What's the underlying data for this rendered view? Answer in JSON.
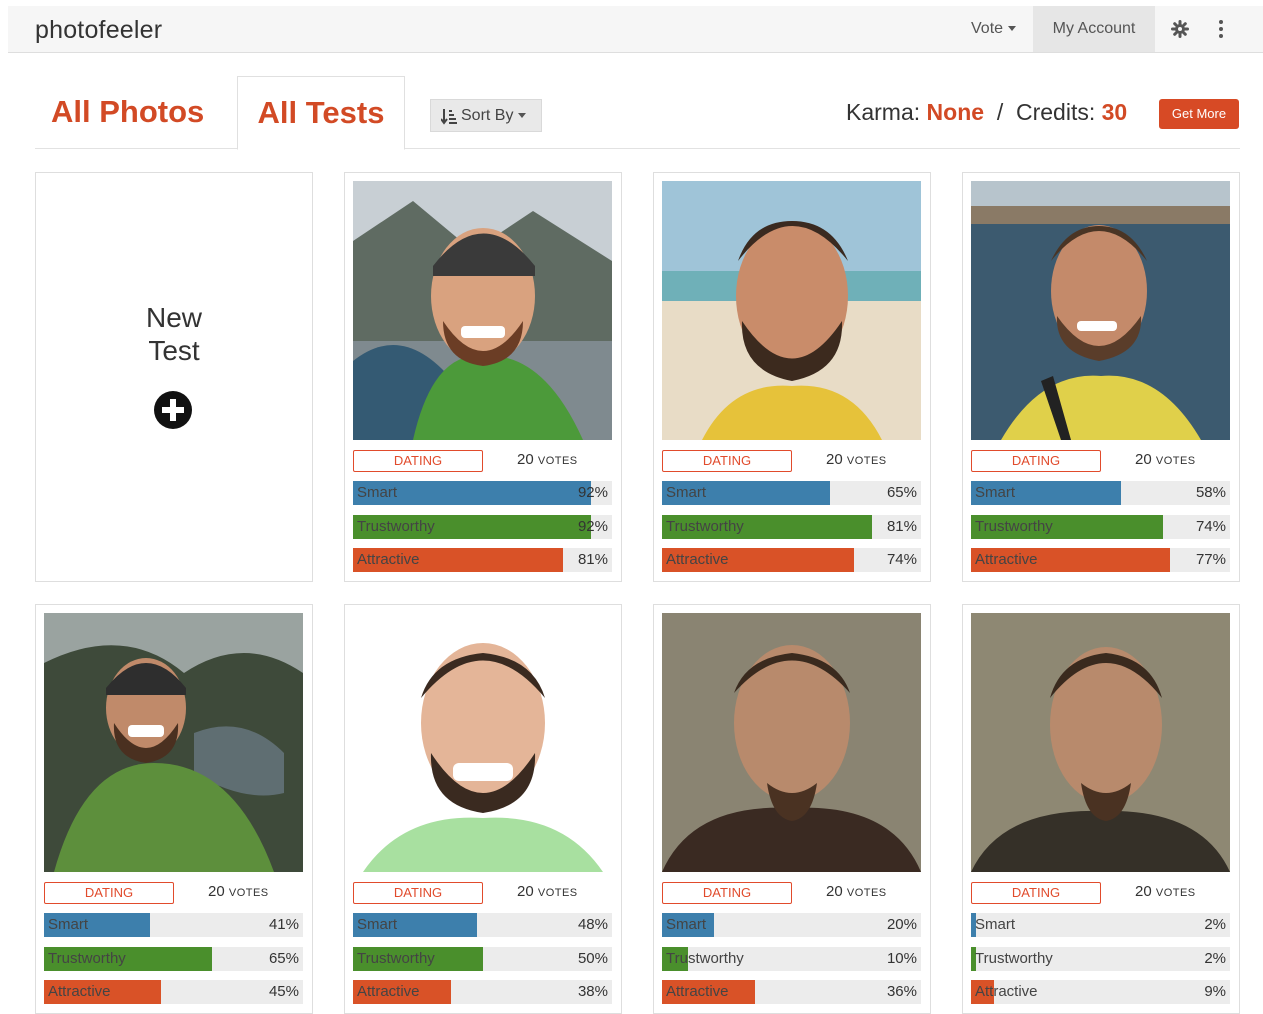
{
  "app": {
    "logo": "photofeeler"
  },
  "nav": {
    "vote": "Vote",
    "account": "My Account"
  },
  "tabs": [
    {
      "label": "All Photos"
    },
    {
      "label": "All Tests"
    }
  ],
  "sort": {
    "label": "Sort By"
  },
  "karma": {
    "label": "Karma:",
    "value": "None",
    "sep": "/",
    "credits_label": "Credits:",
    "credits_value": "30",
    "get_more": "Get More"
  },
  "new_test": {
    "line1": "New",
    "line2": "Test"
  },
  "colors": {
    "accent": "#d24a25",
    "smart": "#3d7fac",
    "trustworthy": "#4a8f2c",
    "attractive": "#d95227"
  },
  "labels": {
    "smart": "Smart",
    "trust": "Trustworthy",
    "attr": "Attractive",
    "votes_word": "VOTES"
  },
  "tests": [
    {
      "category": "DATING",
      "votes": "20",
      "smart": 92,
      "trust": 92,
      "attr": 81
    },
    {
      "category": "DATING",
      "votes": "20",
      "smart": 65,
      "trust": 81,
      "attr": 74
    },
    {
      "category": "DATING",
      "votes": "20",
      "smart": 58,
      "trust": 74,
      "attr": 77
    },
    {
      "category": "DATING",
      "votes": "20",
      "smart": 41,
      "trust": 65,
      "attr": 45
    },
    {
      "category": "DATING",
      "votes": "20",
      "smart": 48,
      "trust": 50,
      "attr": 38
    },
    {
      "category": "DATING",
      "votes": "20",
      "smart": 20,
      "trust": 10,
      "attr": 36
    },
    {
      "category": "DATING",
      "votes": "20",
      "smart": 2,
      "trust": 2,
      "attr": 9
    }
  ]
}
